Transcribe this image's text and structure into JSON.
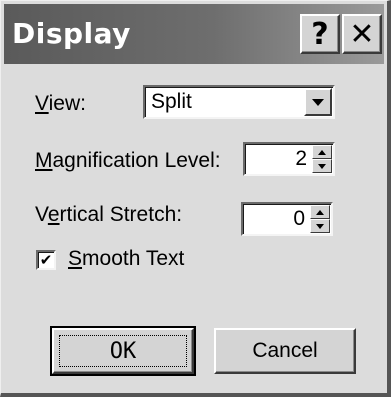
{
  "window": {
    "title": "Display",
    "help_glyph": "?",
    "close_glyph": "✕"
  },
  "view": {
    "label_accel": "V",
    "label_rest": "iew:",
    "selected": "Split"
  },
  "magnification": {
    "label_accel": "M",
    "label_rest": "agnification Level:",
    "value": "2"
  },
  "stretch": {
    "label_pre": "V",
    "label_accel": "e",
    "label_rest": "rtical Stretch:",
    "value": "0"
  },
  "smooth_text": {
    "checked": true,
    "check_glyph": "✔",
    "label_accel": "S",
    "label_rest": "mooth Text"
  },
  "buttons": {
    "ok_label": "OK",
    "cancel_label": "Cancel"
  }
}
